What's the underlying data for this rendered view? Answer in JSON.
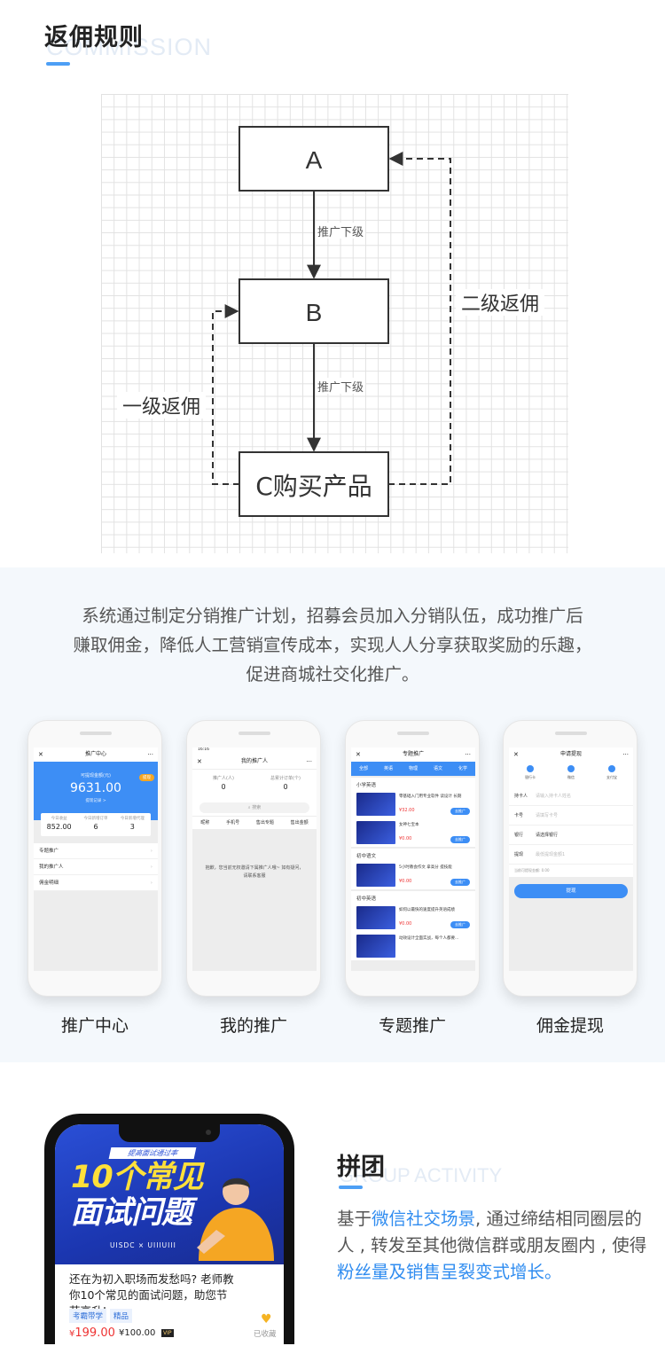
{
  "rules": {
    "title": "返佣规则",
    "subtitle": "COMMISSION",
    "diagram": {
      "node_a": "A",
      "node_b": "B",
      "node_c": "C购买产品",
      "edge_ab": "推广下级",
      "edge_bc": "推广下级",
      "level1": "一级返佣",
      "level2": "二级返佣"
    }
  },
  "intro": {
    "lines": [
      "系统通过制定分销推广计划，招募会员加入分销队伍，成功推广后",
      "赚取佣金，降低人工营销宣传成本，实现人人分享获取奖励的乐趣，",
      "促进商城社交化推广。"
    ]
  },
  "phones": [
    {
      "label": "推广中心",
      "header": "推广中心",
      "balance_label": "可提现金额(元)",
      "balance": "9631.00",
      "withdraw_link": "提现记录 >",
      "badge": "提现",
      "stats": [
        {
          "k": "今日收益",
          "v": "852.00"
        },
        {
          "k": "今日新增订单",
          "v": "6"
        },
        {
          "k": "今日新增代理",
          "v": "3"
        }
      ],
      "menu": [
        "专题推广",
        "我的推广人",
        "佣金明细"
      ]
    },
    {
      "label": "我的推广",
      "status_time": "16:16",
      "header": "我的推广人",
      "stats": [
        {
          "k": "推广人(人)",
          "v": "0"
        },
        {
          "k": "总累计订单(个)",
          "v": "0"
        }
      ],
      "search_placeholder": "搜索",
      "columns": [
        "昵称",
        "手机号",
        "售出专题",
        "售出金额"
      ],
      "empty_text": "抱歉，您当前无权邀请下属推广人哦~ 如有疑问，请联系客服"
    },
    {
      "label": "专题推广",
      "header": "专题推广",
      "tabs": [
        "全部",
        "英语",
        "物理",
        "语文",
        "化学"
      ],
      "sections": [
        {
          "name": "小学英语",
          "items": [
            {
              "title": "零基础入门用专业软件 读设计 长期",
              "price": "¥32.00",
              "btn": "去推广"
            },
            {
              "title": "女神七宝本",
              "price": "¥0.00",
              "btn": "去推广"
            }
          ]
        },
        {
          "name": "初中语文",
          "items": [
            {
              "title": "5小时教会作文 拿高分 提技能",
              "price": "¥0.00",
              "btn": "去推广"
            }
          ]
        },
        {
          "name": "初中英语",
          "items": [
            {
              "title": "如何以最快的速度提升英语成绩",
              "price": "¥0.00",
              "btn": "去推广"
            },
            {
              "title": "动效设计全面实战，每个人都要...",
              "price": "",
              "btn": ""
            }
          ]
        }
      ]
    },
    {
      "label": "佣金提现",
      "header": "申请提现",
      "steps": [
        "银行卡",
        "微信",
        "支付宝"
      ],
      "rows": [
        {
          "k": "持卡人",
          "v": "请输入持卡人姓名"
        },
        {
          "k": "卡号",
          "v": "请填写卡号"
        },
        {
          "k": "银行",
          "v": "请选择银行"
        },
        {
          "k": "提现",
          "v": "最低提现金额1"
        }
      ],
      "note": "当前可提现金额: 0.00",
      "submit": "提现"
    }
  ],
  "group": {
    "title": "拼团",
    "subtitle": "GROUP ACTIVITY",
    "text_parts": [
      {
        "t": "基于",
        "hl": false
      },
      {
        "t": "微信社交场景",
        "hl": true
      },
      {
        "t": ", 通过缔结相同圈层的人 , 转发至其他微信群或朋友圈内 , 使得",
        "hl": false
      },
      {
        "t": "粉丝量及销售呈裂变式增长",
        "hl": true
      },
      {
        "t": "。",
        "hl": true
      }
    ],
    "phone": {
      "tag": "提高面试通过率",
      "headline_1": "10个常见",
      "headline_2": "面试问题",
      "brand": "UISDC × UIIIUIII",
      "question": "还在为初入职场而发愁吗? 老师教你10个常见的面试问题，助您节节高升!",
      "chips": [
        "考霸带学",
        "精品"
      ],
      "price": "199.00",
      "currency": "¥",
      "vip_price": "¥100.00",
      "vip_tag": "VIP",
      "fav": "已收藏"
    }
  },
  "colors": {
    "accent": "#3d8ef5",
    "highlight": "#2f8cf0",
    "price": "#e33333"
  }
}
